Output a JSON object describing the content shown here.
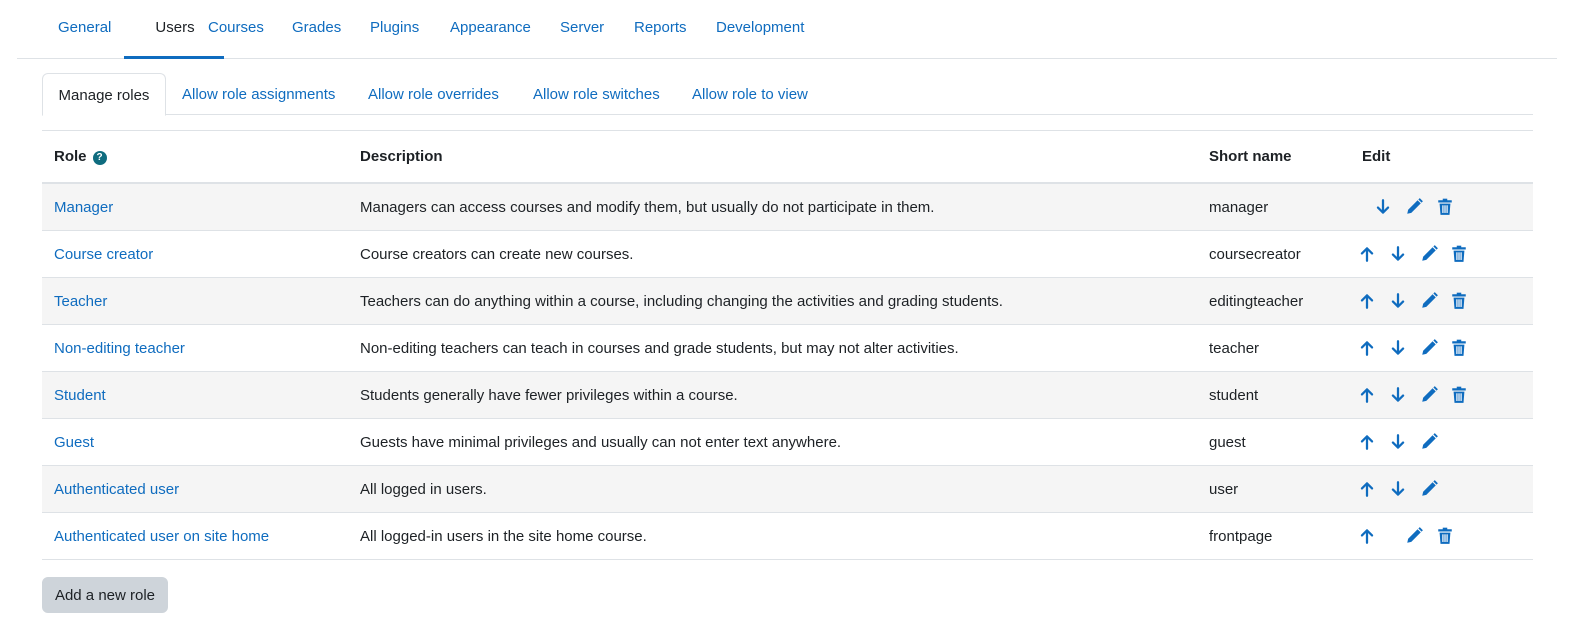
{
  "top_tabs": {
    "general": "General",
    "users": "Users",
    "courses": "Courses",
    "grades": "Grades",
    "plugins": "Plugins",
    "appearance": "Appearance",
    "server": "Server",
    "reports": "Reports",
    "development": "Development"
  },
  "sub_tabs": {
    "manage_roles": "Manage roles",
    "allow_assignments": "Allow role assignments",
    "allow_overrides": "Allow role overrides",
    "allow_switches": "Allow role switches",
    "allow_view": "Allow role to view"
  },
  "table": {
    "headers": {
      "role": "Role",
      "description": "Description",
      "short_name": "Short name",
      "edit": "Edit"
    },
    "help_glyph": "?",
    "rows": [
      {
        "role": "Manager",
        "description": "Managers can access courses and modify them, but usually do not participate in them.",
        "short_name": "manager",
        "actions": [
          "down",
          "edit",
          "delete"
        ]
      },
      {
        "role": "Course creator",
        "description": "Course creators can create new courses.",
        "short_name": "coursecreator",
        "actions": [
          "up",
          "down",
          "edit",
          "delete"
        ]
      },
      {
        "role": "Teacher",
        "description": "Teachers can do anything within a course, including changing the activities and grading students.",
        "short_name": "editingteacher",
        "actions": [
          "up",
          "down",
          "edit",
          "delete"
        ]
      },
      {
        "role": "Non-editing teacher",
        "description": "Non-editing teachers can teach in courses and grade students, but may not alter activities.",
        "short_name": "teacher",
        "actions": [
          "up",
          "down",
          "edit",
          "delete"
        ]
      },
      {
        "role": "Student",
        "description": "Students generally have fewer privileges within a course.",
        "short_name": "student",
        "actions": [
          "up",
          "down",
          "edit",
          "delete"
        ]
      },
      {
        "role": "Guest",
        "description": "Guests have minimal privileges and usually can not enter text anywhere.",
        "short_name": "guest",
        "actions": [
          "up",
          "down",
          "edit"
        ]
      },
      {
        "role": "Authenticated user",
        "description": "All logged in users.",
        "short_name": "user",
        "actions": [
          "up",
          "down",
          "edit"
        ]
      },
      {
        "role": "Authenticated user on site home",
        "description": "All logged-in users in the site home course.",
        "short_name": "frontpage",
        "actions": [
          "up",
          "edit",
          "delete"
        ]
      }
    ]
  },
  "add_button_label": "Add a new role",
  "icons": {
    "up": "arrow-up-icon",
    "down": "arrow-down-icon",
    "edit": "pencil-icon",
    "delete": "trash-icon",
    "help": "help-icon"
  },
  "colors": {
    "link": "#0f6cbf",
    "text": "#1d2125",
    "stripe": "#f5f5f5",
    "border": "#dee2e6",
    "help_badge": "#0f6c7f",
    "button_bg": "#ced4da"
  }
}
